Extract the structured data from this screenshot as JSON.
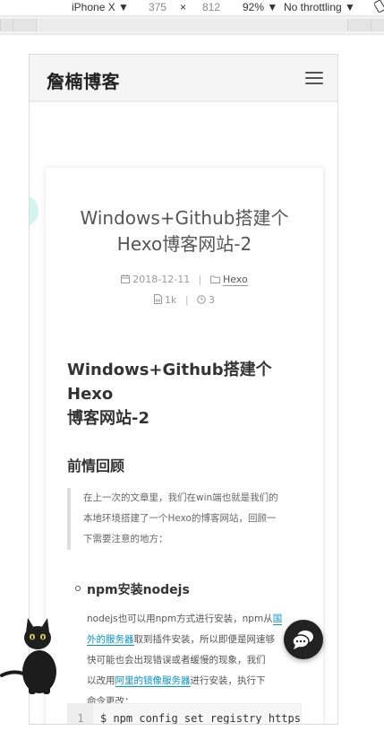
{
  "devtools": {
    "device": "iPhone X",
    "width": "375",
    "times": "×",
    "height": "812",
    "zoom": "92%",
    "throttle": "No throttling"
  },
  "site": {
    "title": "詹楠博客"
  },
  "post": {
    "title_line1": "Windows+Github搭建个",
    "title_line2": "Hexo博客网站-2",
    "date": "2018-12-11",
    "category": "Hexo",
    "words": "1k",
    "read_time": "3"
  },
  "article": {
    "h1_line1": "Windows+Github搭建个Hexo",
    "h1_line2": "博客网站-2",
    "h2": "前情回顾",
    "quote_l1": "在上一次的文章里，我们在win端也就是我们的",
    "quote_l2": "本地环境搭建了一个Hexo的博客网站，回顾一",
    "quote_l3": "下需要注意的地方：",
    "list_title": "npm安装nodejs",
    "p_l1a": "nodejs也可以用npm方式进行安装，npm从",
    "p_l1_link": "国",
    "p_l2_link": "外的服务器",
    "p_l2b": "取到插件安装，所以即便是网速够",
    "p_l3": "快可能也会出现错误或者缓慢的现象，我们",
    "p_l4a": "以改用",
    "p_l4_link": "阿里的镜像服务器",
    "p_l4b": "进行安装，执行下",
    "p_l5": "命令更改：",
    "code_line_no": "1",
    "code": "$ npm config set registry https://r"
  },
  "icons": {
    "menu": "hamburger-icon",
    "calendar": "calendar-icon",
    "folder": "folder-icon",
    "file": "file-word-icon",
    "clock": "clock-icon",
    "chat": "chat-bubble-icon",
    "cat": "black-cat-mascot"
  },
  "colors": {
    "link": "#0593d3",
    "title": "#555555",
    "chat_button": "#222222"
  }
}
